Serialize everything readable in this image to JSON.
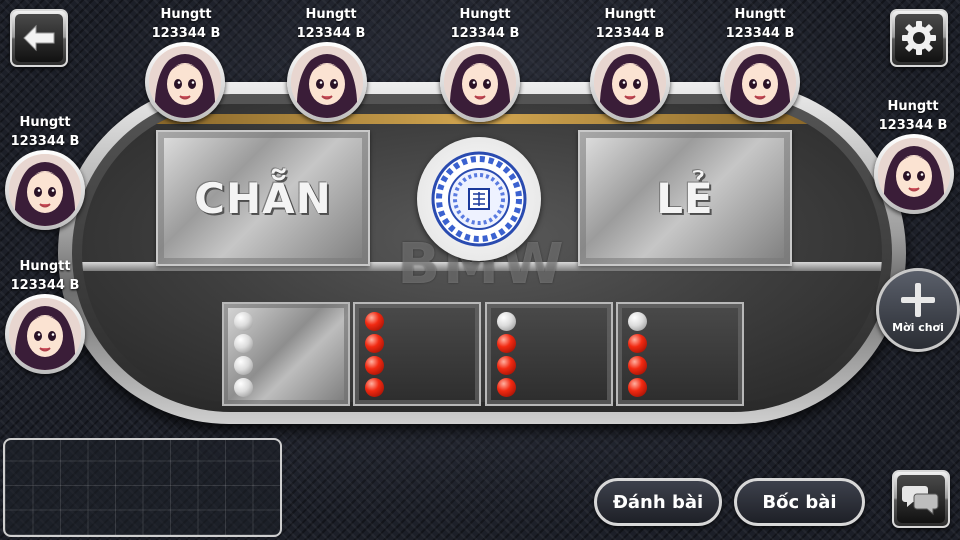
{
  "players_top": [
    {
      "name": "Hungtt",
      "money": "123344 B"
    },
    {
      "name": "Hungtt",
      "money": "123344 B"
    },
    {
      "name": "Hungtt",
      "money": "123344 B"
    },
    {
      "name": "Hungtt",
      "money": "123344 B"
    },
    {
      "name": "Hungtt",
      "money": "123344 B"
    }
  ],
  "players_left": [
    {
      "name": "Hungtt",
      "money": "123344 B"
    },
    {
      "name": "Hungtt",
      "money": "123344 B"
    }
  ],
  "players_right": [
    {
      "name": "Hungtt",
      "money": "123344 B"
    }
  ],
  "table": {
    "watermark": "BMW",
    "bet_even": "CHẴN",
    "bet_odd": "LẺ"
  },
  "results": [
    {
      "balls": [
        "white",
        "white",
        "white",
        "white"
      ]
    },
    {
      "balls": [
        "red",
        "red",
        "red",
        "red"
      ]
    },
    {
      "balls": [
        "white",
        "red",
        "red",
        "red"
      ]
    },
    {
      "balls": [
        "white",
        "red",
        "red",
        "red"
      ]
    }
  ],
  "invite": {
    "label": "Mời chơi"
  },
  "actions": {
    "deal": "Đánh bài",
    "draw": "Bốc bài"
  },
  "icons": {
    "back": "back-arrow-icon",
    "settings": "gear-icon",
    "chat": "chat-bubbles-icon",
    "invite": "plus-icon"
  },
  "colors": {
    "gold": "#d2a650",
    "red_ball": "#f22a12",
    "white_ball": "#dcdcdc"
  }
}
